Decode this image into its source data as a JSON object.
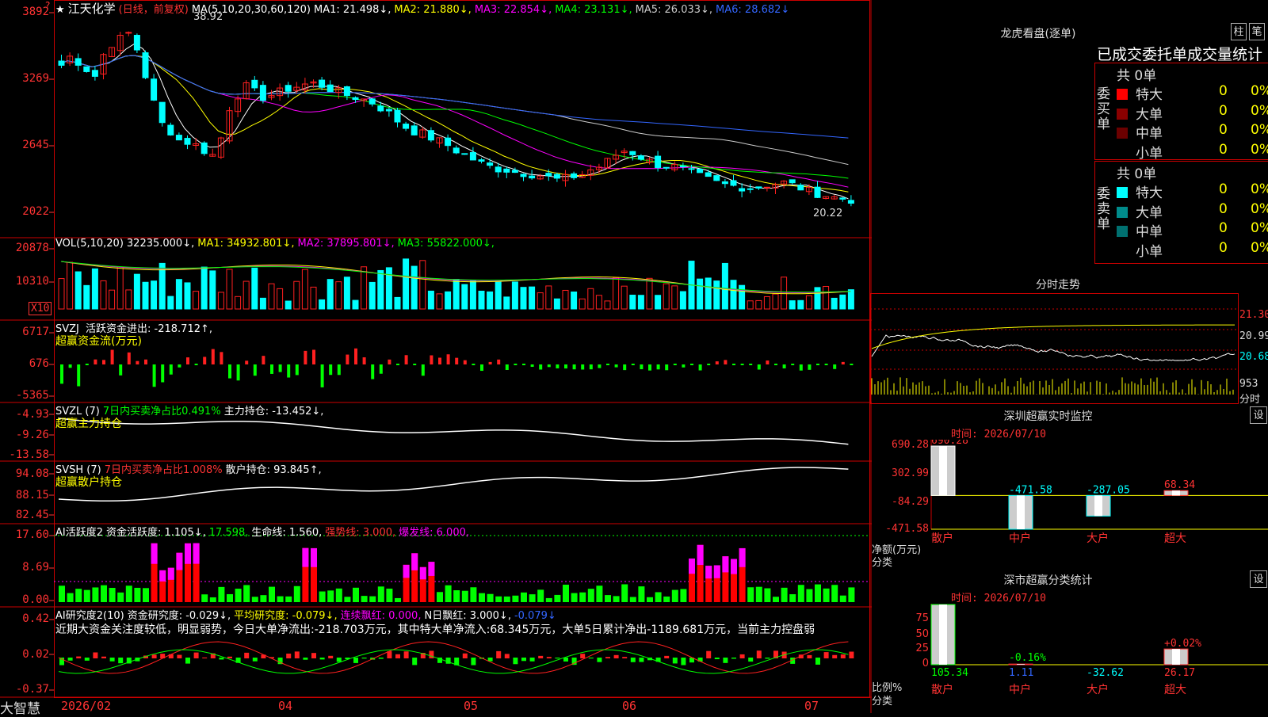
{
  "header": {
    "star": "★",
    "stock_name": "江天化学",
    "mode": "(日线，前复权)",
    "ma_label": "MA(5,10,20,30,60,120)",
    "ma1": "MA1: 21.498↓,",
    "ma2": "MA2: 21.880↓,",
    "ma3": "MA3: 22.854↓,",
    "ma4": "MA4: 23.131↓,",
    "ma5": "MA5: 26.033↓,",
    "ma6": "MA6: 28.682↓",
    "high_label": "38.92",
    "low_label": "20.22",
    "question": "?"
  },
  "price_axis": [
    "3892",
    "3269",
    "2645",
    "2022"
  ],
  "vol": {
    "label": "VOL(5,10,20)",
    "value": "32235.000↓,",
    "ma1": "MA1: 34932.801↓,",
    "ma2": "MA2: 37895.801↓,",
    "ma3": "MA3: 55822.000↓,",
    "axis": [
      "20878",
      "10310"
    ],
    "unit": "X10"
  },
  "svzj": {
    "label": "SVZJ",
    "line1": "活跃资金进出: -218.712↑,",
    "line2": "超赢资金流(万元)",
    "axis": [
      "6717",
      "676",
      "-5365"
    ]
  },
  "svzl": {
    "label": "SVZL (7)",
    "text1": "7日内买卖净占比0.491%",
    "text2": "主力持仓: -13.452↓,",
    "line2": "超赢主力持仓",
    "axis": [
      "-4.93",
      "-9.26",
      "-13.58"
    ]
  },
  "svsh": {
    "label": "SVSH (7)",
    "text1": "7日内买卖净占比1.008%",
    "text2": "散户持仓: 93.845↑,",
    "line2": "超赢散户持仓",
    "axis": [
      "94.08",
      "88.15",
      "82.45"
    ]
  },
  "ai1": {
    "label": "AI活跃度2",
    "t1": "资金活跃度: 1.105↓,",
    "t2": "17.598,",
    "t3": "生命线: 1.560,",
    "t4": "强势线: 3.000,",
    "t5": "爆发线: 6.000,",
    "axis": [
      "17.60",
      "8.69",
      "0.00"
    ]
  },
  "ai2": {
    "label": "AI研究度2(10)",
    "t1": "资金研究度: -0.029↓,",
    "t2": "平均研究度: -0.079↓,",
    "t3": "连续飘红: 0.000,",
    "t4": "N日飘红: 3.000↓,",
    "t5": "-0.079↓",
    "comment": "近期大资金关注度较低，明显弱势，今日大单净流出:-218.703万元，其中特大单净流入:68.345万元，大单5日累计净出-1189.681万元，当前主力控盘弱",
    "axis": [
      "0.42",
      "0.02",
      "-0.37"
    ]
  },
  "dates": {
    "app": "大智慧",
    "d1": "2026/02",
    "d2": "04",
    "d3": "05",
    "d4": "06",
    "d5": "07"
  },
  "longhu": {
    "title": "龙虎看盘(逐单)",
    "btn1": "柱",
    "btn2": "笔",
    "heading": "已成交委托单成交量统计",
    "buy_label": "委买单",
    "sell_label": "委卖单",
    "buy_total": "共 0单",
    "sell_total": "共 0单",
    "buy_rows": [
      {
        "name": "特大",
        "val": "0",
        "pct": "0%",
        "color": "#ff0000"
      },
      {
        "name": "大单",
        "val": "0",
        "pct": "0%",
        "color": "#8b0000"
      },
      {
        "name": "中单",
        "val": "0",
        "pct": "0%",
        "color": "#6b0000"
      },
      {
        "name": "小单",
        "val": "0",
        "pct": "0%",
        "color": "#000000"
      }
    ],
    "sell_rows": [
      {
        "name": "特大",
        "val": "0",
        "pct": "0%",
        "color": "#00ffff"
      },
      {
        "name": "大单",
        "val": "0",
        "pct": "0%",
        "color": "#008b8b"
      },
      {
        "name": "中单",
        "val": "0",
        "pct": "0%",
        "color": "#007070"
      },
      {
        "name": "小单",
        "val": "0",
        "pct": "0%",
        "color": "#000000"
      }
    ]
  },
  "fenshi": {
    "title": "分时走势",
    "p1": "21.30",
    "p2": "20.99",
    "p3": "20.68",
    "v1": "953",
    "v2": "分时"
  },
  "monitor": {
    "title": "深圳超赢实时监控",
    "btn": "设",
    "time": "时间: 2026/07/10",
    "axis": [
      "690.28",
      "302.99",
      "-84.29",
      "-471.58"
    ],
    "ylabel": "净额(万元)",
    "xlabel": "分类",
    "bars": [
      {
        "name": "散户",
        "value": 690.28,
        "label": "690.28"
      },
      {
        "name": "中户",
        "value": -471.58,
        "label": "-471.58"
      },
      {
        "name": "大户",
        "value": -287.05,
        "label": "-287.05"
      },
      {
        "name": "超大",
        "value": 68.34,
        "label": "68.34"
      }
    ]
  },
  "classify": {
    "title": "深市超赢分类统计",
    "btn": "设",
    "time": "时间: 2026/07/10",
    "axis": [
      "75",
      "50",
      "25",
      "0"
    ],
    "ylabel": "比例%",
    "xlabel": "分类",
    "bars": [
      {
        "name": "散户",
        "value": 105.34,
        "label": "105.34"
      },
      {
        "name": "中户",
        "value": 1.11,
        "label": "1.11"
      },
      {
        "name": "大户",
        "value": -32.62,
        "label": "-32.62"
      },
      {
        "name": "超大",
        "value": 26.17,
        "label": "26.17"
      }
    ],
    "pct_mid": "-0.16%",
    "pct_big": "+0.02%"
  }
}
